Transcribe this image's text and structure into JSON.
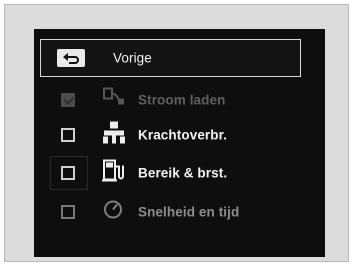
{
  "menu": {
    "back": {
      "label": "Vorige",
      "icon": "back-arrow-icon"
    },
    "items": [
      {
        "label": "Stroom laden",
        "checked": true,
        "enabled": false,
        "icon": "charging-plug-icon"
      },
      {
        "label": "Krachtoverbr.",
        "checked": false,
        "enabled": true,
        "icon": "power-flow-icon"
      },
      {
        "label": "Bereik & brst.",
        "checked": false,
        "enabled": true,
        "icon": "fuel-range-icon"
      },
      {
        "label": "Snelheid en tijd",
        "checked": false,
        "enabled": true,
        "icon": "speed-time-icon"
      }
    ]
  },
  "colors": {
    "screen": "#0e0e0e",
    "frame": "#dcdcdc",
    "text": "#f2f2f2"
  }
}
